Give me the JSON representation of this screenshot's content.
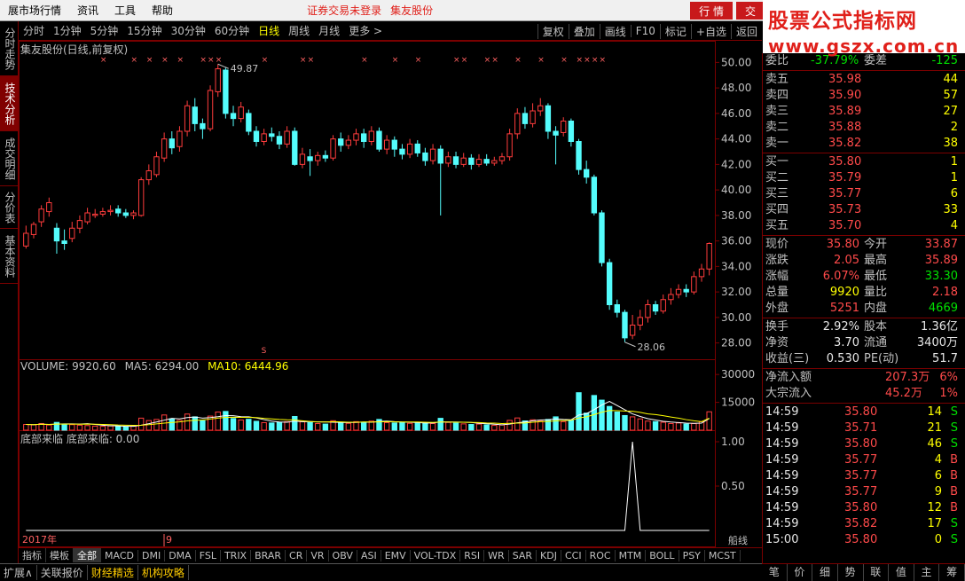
{
  "menubar": {
    "items": [
      "展市场行情",
      "资讯",
      "工具",
      "帮助"
    ],
    "notice": "证券交易未登录",
    "stock_name": "集友股份",
    "right_tabs": [
      "行 情",
      "交"
    ]
  },
  "watermark": {
    "line1": "股票公式指标网",
    "line2": "www.gszx.com.cn"
  },
  "left_tabs": [
    "分时走势",
    "技术分析",
    "成交明细",
    "分价表",
    "基本资料"
  ],
  "left_tab_active": 1,
  "periods": [
    "分时",
    "1分钟",
    "5分钟",
    "15分钟",
    "30分钟",
    "60分钟",
    "日线",
    "周线",
    "月线",
    "更多 >"
  ],
  "period_active": 6,
  "tools": [
    "复权",
    "叠加",
    "画线",
    "F10",
    "标记",
    "+自选",
    "返回"
  ],
  "chart": {
    "title": "集友股份(日线,前复权)",
    "high_label": "49.87",
    "low_label": "28.06",
    "price_axis": [
      "50.00",
      "48.00",
      "46.00",
      "44.00",
      "42.00",
      "40.00",
      "38.00",
      "36.00",
      "34.00",
      "32.00",
      "30.00",
      "28.00"
    ],
    "volume_header": {
      "volume": "VOLUME: 9920.60",
      "ma5": "MA5: 6294.00",
      "ma10": "MA10: 6444.96"
    },
    "volume_axis": [
      "30000",
      "15000"
    ],
    "indicator_header": "底部来临  底部来临: 0.00",
    "indicator_axis": [
      "1.00",
      "0.50"
    ],
    "date_left": "2017年",
    "date_mid": "9",
    "s_mark": "S",
    "right_tag": "船线"
  },
  "chart_data": {
    "type": "candlestick",
    "title": "集友股份(日线,前复权)",
    "ylim": [
      27,
      51
    ],
    "candles": [
      {
        "o": 35.6,
        "c": 36.6,
        "h": 37.2,
        "l": 35.4
      },
      {
        "o": 36.5,
        "c": 37.3,
        "h": 37.5,
        "l": 36.2
      },
      {
        "o": 37.5,
        "c": 38.5,
        "h": 38.8,
        "l": 37.1
      },
      {
        "o": 38.3,
        "c": 39.0,
        "h": 39.4,
        "l": 37.9
      },
      {
        "o": 37.0,
        "c": 36.0,
        "h": 37.4,
        "l": 35.0
      },
      {
        "o": 36.0,
        "c": 35.8,
        "h": 36.9,
        "l": 35.3
      },
      {
        "o": 36.2,
        "c": 37.0,
        "h": 37.5,
        "l": 35.9
      },
      {
        "o": 37.0,
        "c": 37.6,
        "h": 38.0,
        "l": 36.6
      },
      {
        "o": 37.5,
        "c": 38.2,
        "h": 38.6,
        "l": 37.3
      },
      {
        "o": 38.0,
        "c": 38.1,
        "h": 38.5,
        "l": 37.8
      },
      {
        "o": 38.1,
        "c": 38.3,
        "h": 38.6,
        "l": 37.9
      },
      {
        "o": 38.3,
        "c": 38.4,
        "h": 38.8,
        "l": 38.0
      },
      {
        "o": 38.5,
        "c": 38.2,
        "h": 38.8,
        "l": 37.9
      },
      {
        "o": 38.2,
        "c": 38.0,
        "h": 38.5,
        "l": 37.8
      },
      {
        "o": 38.0,
        "c": 38.2,
        "h": 38.4,
        "l": 37.7
      },
      {
        "o": 38.0,
        "c": 40.8,
        "h": 41.0,
        "l": 37.9
      },
      {
        "o": 40.8,
        "c": 41.5,
        "h": 42.0,
        "l": 40.4
      },
      {
        "o": 41.2,
        "c": 42.6,
        "h": 43.0,
        "l": 41.0
      },
      {
        "o": 42.5,
        "c": 44.0,
        "h": 44.5,
        "l": 42.2
      },
      {
        "o": 44.0,
        "c": 43.3,
        "h": 44.6,
        "l": 42.8
      },
      {
        "o": 43.4,
        "c": 44.6,
        "h": 45.0,
        "l": 43.0
      },
      {
        "o": 44.6,
        "c": 46.6,
        "h": 47.0,
        "l": 44.2
      },
      {
        "o": 46.5,
        "c": 45.2,
        "h": 47.2,
        "l": 44.6
      },
      {
        "o": 45.2,
        "c": 44.8,
        "h": 45.6,
        "l": 44.0
      },
      {
        "o": 44.8,
        "c": 47.8,
        "h": 48.2,
        "l": 44.6
      },
      {
        "o": 47.7,
        "c": 49.5,
        "h": 49.87,
        "l": 47.3
      },
      {
        "o": 49.4,
        "c": 46.0,
        "h": 49.6,
        "l": 45.6
      },
      {
        "o": 46.0,
        "c": 45.6,
        "h": 46.6,
        "l": 45.0
      },
      {
        "o": 45.6,
        "c": 46.5,
        "h": 46.9,
        "l": 45.3
      },
      {
        "o": 46.0,
        "c": 44.6,
        "h": 46.3,
        "l": 44.3
      },
      {
        "o": 44.6,
        "c": 43.8,
        "h": 45.0,
        "l": 43.4
      },
      {
        "o": 43.8,
        "c": 44.4,
        "h": 44.8,
        "l": 43.5
      },
      {
        "o": 44.4,
        "c": 44.2,
        "h": 44.9,
        "l": 43.8
      },
      {
        "o": 44.2,
        "c": 43.6,
        "h": 44.6,
        "l": 43.2
      },
      {
        "o": 43.6,
        "c": 44.6,
        "h": 45.0,
        "l": 43.3
      },
      {
        "o": 44.6,
        "c": 42.0,
        "h": 44.9,
        "l": 41.9
      },
      {
        "o": 42.0,
        "c": 42.8,
        "h": 43.3,
        "l": 41.7
      },
      {
        "o": 42.6,
        "c": 42.3,
        "h": 43.2,
        "l": 41.1
      },
      {
        "o": 42.3,
        "c": 42.7,
        "h": 43.0,
        "l": 41.9
      },
      {
        "o": 42.7,
        "c": 42.5,
        "h": 43.1,
        "l": 42.2
      },
      {
        "o": 42.5,
        "c": 44.0,
        "h": 44.3,
        "l": 42.3
      },
      {
        "o": 44.0,
        "c": 43.5,
        "h": 44.5,
        "l": 43.0
      },
      {
        "o": 43.5,
        "c": 43.9,
        "h": 44.3,
        "l": 43.2
      },
      {
        "o": 43.9,
        "c": 44.4,
        "h": 44.8,
        "l": 43.5
      },
      {
        "o": 44.4,
        "c": 43.8,
        "h": 44.8,
        "l": 43.3
      },
      {
        "o": 43.8,
        "c": 44.6,
        "h": 45.0,
        "l": 43.5
      },
      {
        "o": 44.6,
        "c": 43.2,
        "h": 44.9,
        "l": 43.0
      },
      {
        "o": 43.2,
        "c": 43.9,
        "h": 44.3,
        "l": 42.8
      },
      {
        "o": 43.9,
        "c": 43.2,
        "h": 44.2,
        "l": 42.6
      },
      {
        "o": 43.2,
        "c": 42.8,
        "h": 43.6,
        "l": 42.4
      },
      {
        "o": 42.8,
        "c": 43.6,
        "h": 44.0,
        "l": 42.5
      },
      {
        "o": 43.6,
        "c": 42.9,
        "h": 43.9,
        "l": 42.6
      },
      {
        "o": 42.9,
        "c": 42.3,
        "h": 43.3,
        "l": 41.9
      },
      {
        "o": 42.3,
        "c": 43.2,
        "h": 43.6,
        "l": 42.0
      },
      {
        "o": 43.2,
        "c": 42.1,
        "h": 43.5,
        "l": 38.0
      },
      {
        "o": 42.1,
        "c": 42.6,
        "h": 43.0,
        "l": 41.8
      },
      {
        "o": 42.6,
        "c": 42.0,
        "h": 43.0,
        "l": 41.7
      },
      {
        "o": 42.0,
        "c": 42.5,
        "h": 42.9,
        "l": 41.8
      },
      {
        "o": 42.5,
        "c": 42.0,
        "h": 42.8,
        "l": 41.6
      },
      {
        "o": 42.0,
        "c": 42.4,
        "h": 42.8,
        "l": 41.8
      },
      {
        "o": 42.4,
        "c": 42.1,
        "h": 42.8,
        "l": 41.9
      },
      {
        "o": 42.1,
        "c": 42.3,
        "h": 42.6,
        "l": 41.9
      },
      {
        "o": 42.3,
        "c": 42.6,
        "h": 42.9,
        "l": 42.0
      },
      {
        "o": 42.6,
        "c": 44.4,
        "h": 44.8,
        "l": 42.3
      },
      {
        "o": 44.4,
        "c": 46.0,
        "h": 46.4,
        "l": 44.0
      },
      {
        "o": 46.0,
        "c": 45.2,
        "h": 46.5,
        "l": 44.8
      },
      {
        "o": 45.2,
        "c": 46.2,
        "h": 46.8,
        "l": 44.9
      },
      {
        "o": 46.2,
        "c": 46.6,
        "h": 47.2,
        "l": 45.8
      },
      {
        "o": 46.6,
        "c": 44.6,
        "h": 46.8,
        "l": 44.0
      },
      {
        "o": 44.6,
        "c": 44.3,
        "h": 45.0,
        "l": 42.0
      },
      {
        "o": 44.5,
        "c": 45.4,
        "h": 45.7,
        "l": 44.2
      },
      {
        "o": 45.4,
        "c": 43.8,
        "h": 45.6,
        "l": 43.4
      },
      {
        "o": 43.8,
        "c": 41.6,
        "h": 44.0,
        "l": 41.2
      },
      {
        "o": 41.6,
        "c": 41.0,
        "h": 42.3,
        "l": 40.5
      },
      {
        "o": 41.0,
        "c": 38.2,
        "h": 41.2,
        "l": 38.0
      },
      {
        "o": 38.2,
        "c": 34.3,
        "h": 38.4,
        "l": 34.0
      },
      {
        "o": 34.3,
        "c": 31.0,
        "h": 34.6,
        "l": 30.6
      },
      {
        "o": 31.0,
        "c": 30.4,
        "h": 31.4,
        "l": 30.0
      },
      {
        "o": 30.4,
        "c": 28.4,
        "h": 30.6,
        "l": 28.06
      },
      {
        "o": 28.6,
        "c": 29.4,
        "h": 30.2,
        "l": 28.3
      },
      {
        "o": 29.4,
        "c": 30.0,
        "h": 30.6,
        "l": 29.0
      },
      {
        "o": 30.0,
        "c": 31.0,
        "h": 31.4,
        "l": 29.6
      },
      {
        "o": 31.0,
        "c": 30.5,
        "h": 31.3,
        "l": 30.2
      },
      {
        "o": 30.5,
        "c": 31.4,
        "h": 31.8,
        "l": 30.3
      },
      {
        "o": 31.4,
        "c": 31.8,
        "h": 32.3,
        "l": 31.0
      },
      {
        "o": 31.8,
        "c": 32.2,
        "h": 32.6,
        "l": 31.5
      },
      {
        "o": 32.2,
        "c": 32.0,
        "h": 32.6,
        "l": 31.6
      },
      {
        "o": 32.0,
        "c": 33.2,
        "h": 33.6,
        "l": 31.8
      },
      {
        "o": 33.2,
        "c": 33.8,
        "h": 34.2,
        "l": 32.8
      },
      {
        "o": 33.8,
        "c": 35.8,
        "h": 35.89,
        "l": 33.3
      }
    ],
    "volume": [
      3100,
      2900,
      3600,
      2800,
      4200,
      3300,
      3000,
      2700,
      2500,
      2200,
      2100,
      2300,
      2000,
      1900,
      2400,
      6500,
      5200,
      5800,
      8200,
      6100,
      5300,
      8700,
      7200,
      5100,
      7600,
      9800,
      10100,
      6300,
      5500,
      5900,
      4800,
      4100,
      3900,
      4300,
      4600,
      7400,
      4600,
      4100,
      3600,
      3300,
      5100,
      4300,
      3700,
      4600,
      4300,
      4900,
      5800,
      4100,
      3900,
      4100,
      3700,
      4200,
      3900,
      3600,
      6400,
      4200,
      3800,
      3400,
      3100,
      3300,
      2900,
      2600,
      2800,
      5300,
      6600,
      5000,
      5600,
      4900,
      5800,
      7200,
      4600,
      5300,
      20200,
      9200,
      18700,
      16200,
      12800,
      9800,
      7900,
      7200,
      6100,
      4900,
      4600,
      4300,
      3600,
      3900,
      3300,
      3600,
      4600,
      9920
    ],
    "ma5": [
      3100,
      3000,
      3200,
      3100,
      3300,
      3400,
      3400,
      3300,
      3500,
      3100,
      2700,
      2400,
      2300,
      2100,
      2100,
      2700,
      3500,
      4400,
      5400,
      6400,
      6100,
      6800,
      7100,
      6500,
      6800,
      7300,
      7900,
      7800,
      7300,
      7200,
      6600,
      5700,
      4900,
      4400,
      4300,
      4900,
      4600,
      4600,
      4500,
      4500,
      4300,
      4200,
      4100,
      4200,
      4400,
      4300,
      4700,
      4900,
      4600,
      4400,
      4300,
      4100,
      3900,
      3900,
      4500,
      4400,
      4400,
      4300,
      4200,
      3700,
      3500,
      3200,
      2900,
      3300,
      4000,
      4400,
      5100,
      5500,
      5600,
      6100,
      5800,
      5600,
      8200,
      8900,
      11100,
      13600,
      15500,
      13300,
      11000,
      8800,
      7400,
      6200,
      5500,
      4800,
      4400,
      4100,
      3800,
      3700,
      3800,
      6294
    ],
    "ma10": [
      3100,
      3000,
      3200,
      3100,
      3300,
      3300,
      3300,
      3200,
      3300,
      3200,
      3100,
      3000,
      2800,
      2700,
      2600,
      2700,
      3000,
      3400,
      3800,
      4200,
      4500,
      5000,
      5300,
      5500,
      6000,
      6500,
      6900,
      7000,
      6900,
      6900,
      6800,
      6400,
      6100,
      5800,
      5600,
      5500,
      5100,
      4700,
      4500,
      4400,
      4600,
      4500,
      4300,
      4300,
      4400,
      4400,
      4500,
      4600,
      4500,
      4400,
      4400,
      4400,
      4300,
      4200,
      4400,
      4400,
      4300,
      4300,
      4200,
      4100,
      3900,
      3800,
      3600,
      3700,
      3800,
      3900,
      4300,
      4600,
      4700,
      5000,
      5200,
      5400,
      6600,
      7200,
      8400,
      9700,
      10600,
      10500,
      10300,
      10200,
      9600,
      8800,
      8400,
      7800,
      7100,
      6500,
      5700,
      5100,
      4600,
      6445
    ],
    "indicator": {
      "name": "底部来临",
      "spike_index": 79,
      "spike_value": 1.0
    }
  },
  "quote": {
    "top_row": {
      "l1": "委比",
      "v1": "-37.79%",
      "l2": "委差",
      "v2": "-125"
    },
    "asks": [
      {
        "label": "卖五",
        "price": "35.98",
        "vol": "44"
      },
      {
        "label": "卖四",
        "price": "35.90",
        "vol": "57"
      },
      {
        "label": "卖三",
        "price": "35.89",
        "vol": "27"
      },
      {
        "label": "卖二",
        "price": "35.88",
        "vol": "2"
      },
      {
        "label": "卖一",
        "price": "35.82",
        "vol": "38"
      }
    ],
    "bids": [
      {
        "label": "买一",
        "price": "35.80",
        "vol": "1"
      },
      {
        "label": "买二",
        "price": "35.79",
        "vol": "1"
      },
      {
        "label": "买三",
        "price": "35.77",
        "vol": "6"
      },
      {
        "label": "买四",
        "price": "35.73",
        "vol": "33"
      },
      {
        "label": "买五",
        "price": "35.70",
        "vol": "4"
      }
    ],
    "stats": [
      {
        "l1": "现价",
        "v1": "35.80",
        "c1": "red",
        "l2": "今开",
        "v2": "33.87",
        "c2": "red"
      },
      {
        "l1": "涨跌",
        "v1": "2.05",
        "c1": "red",
        "l2": "最高",
        "v2": "35.89",
        "c2": "red"
      },
      {
        "l1": "涨幅",
        "v1": "6.07%",
        "c1": "red",
        "l2": "最低",
        "v2": "33.30",
        "c2": "grn"
      },
      {
        "l1": "总量",
        "v1": "9920",
        "c1": "ylw",
        "l2": "量比",
        "v2": "2.18",
        "c2": "red"
      },
      {
        "l1": "外盘",
        "v1": "5251",
        "c1": "red",
        "l2": "内盘",
        "v2": "4669",
        "c2": "grn"
      }
    ],
    "stats2": [
      {
        "l1": "换手",
        "v1": "2.92%",
        "l2": "股本",
        "v2": "1.36亿"
      },
      {
        "l1": "净资",
        "v1": "3.70",
        "l2": "流通",
        "v2": "3400万"
      },
      {
        "l1": "收益(三)",
        "v1": "0.530",
        "l2": "PE(动)",
        "v2": "51.7"
      }
    ],
    "flows": [
      {
        "label": "净流入额",
        "value": "207.3万",
        "pct": "6%"
      },
      {
        "label": "大宗流入",
        "value": "45.2万",
        "pct": "1%"
      }
    ],
    "ticks": [
      {
        "t": "14:59",
        "p": "35.80",
        "v": "14",
        "s": "S"
      },
      {
        "t": "14:59",
        "p": "35.71",
        "v": "21",
        "s": "S"
      },
      {
        "t": "14:59",
        "p": "35.80",
        "v": "46",
        "s": "S"
      },
      {
        "t": "14:59",
        "p": "35.77",
        "v": "4",
        "s": "B"
      },
      {
        "t": "14:59",
        "p": "35.77",
        "v": "6",
        "s": "B"
      },
      {
        "t": "14:59",
        "p": "35.77",
        "v": "9",
        "s": "B"
      },
      {
        "t": "14:59",
        "p": "35.80",
        "v": "12",
        "s": "B"
      },
      {
        "t": "14:59",
        "p": "35.82",
        "v": "17",
        "s": "S"
      },
      {
        "t": "15:00",
        "p": "35.80",
        "v": "0",
        "s": "S"
      }
    ]
  },
  "indicator_tabs": [
    "指标",
    "模板",
    "全部",
    "MACD",
    "DMI",
    "DMA",
    "FSL",
    "TRIX",
    "BRAR",
    "CR",
    "VR",
    "OBV",
    "ASI",
    "EMV",
    "VOL-TDX",
    "RSI",
    "WR",
    "SAR",
    "KDJ",
    "CCI",
    "ROC",
    "MTM",
    "BOLL",
    "PSY",
    "MCST"
  ],
  "indicator_tab_active": 2,
  "status_bar": [
    "扩展∧",
    "关联报价",
    "财经精选",
    "机构攻略"
  ],
  "right_tabs_bottom": [
    "笔",
    "价",
    "细",
    "势",
    "联",
    "值",
    "主",
    "筹"
  ],
  "colors": {
    "up": "#ff3c3c",
    "down": "#54fcfc",
    "frame": "#7a0000",
    "ma5": "#ffffff",
    "ma10": "#ffff00"
  }
}
